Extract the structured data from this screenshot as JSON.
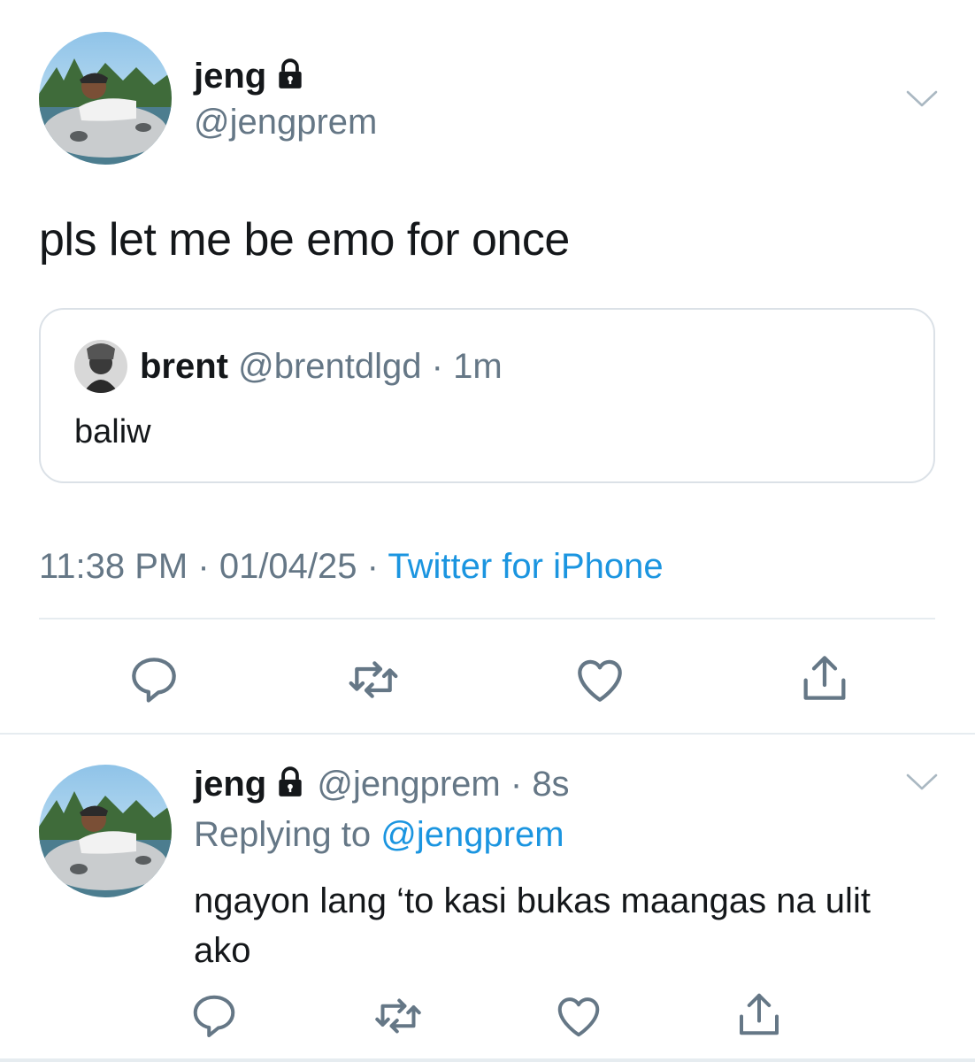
{
  "colors": {
    "text": "#14171a",
    "muted": "#657786",
    "link": "#1b95e0",
    "border": "#dbe1e7",
    "divider": "#e6ecf0"
  },
  "main_tweet": {
    "name": "jeng",
    "handle": "@jengprem",
    "protected_icon": "lock-icon",
    "text": "pls let me be emo for once",
    "quoted": {
      "name": "brent",
      "handle": "@brentdlgd",
      "separator": "·",
      "age": "1m",
      "text": "baliw"
    },
    "time": "11:38 PM",
    "date": "01/04/25",
    "separator": "·",
    "source": "Twitter for iPhone",
    "actions": [
      "reply-icon",
      "retweet-icon",
      "like-icon",
      "share-icon"
    ]
  },
  "reply_tweet": {
    "name": "jeng",
    "handle": "@jengprem",
    "separator": "·",
    "age": "8s",
    "replying_prefix": "Replying to",
    "replying_to": "@jengprem",
    "text": "ngayon lang ‘to kasi bukas maangas na ulit ako",
    "actions": [
      "reply-icon",
      "retweet-icon",
      "like-icon",
      "share-icon"
    ]
  }
}
